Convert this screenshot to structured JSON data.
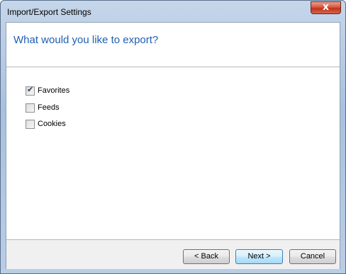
{
  "window": {
    "title": "Import/Export Settings",
    "close_glyph": "x"
  },
  "page": {
    "title": "What would you like to export?"
  },
  "options": [
    {
      "label": "Favorites",
      "checked": true
    },
    {
      "label": "Feeds",
      "checked": false
    },
    {
      "label": "Cookies",
      "checked": false
    }
  ],
  "buttons": {
    "back": "< Back",
    "next": "Next >",
    "cancel": "Cancel"
  },
  "icons": {
    "check": "check-mark-icon",
    "close": "close-icon"
  }
}
